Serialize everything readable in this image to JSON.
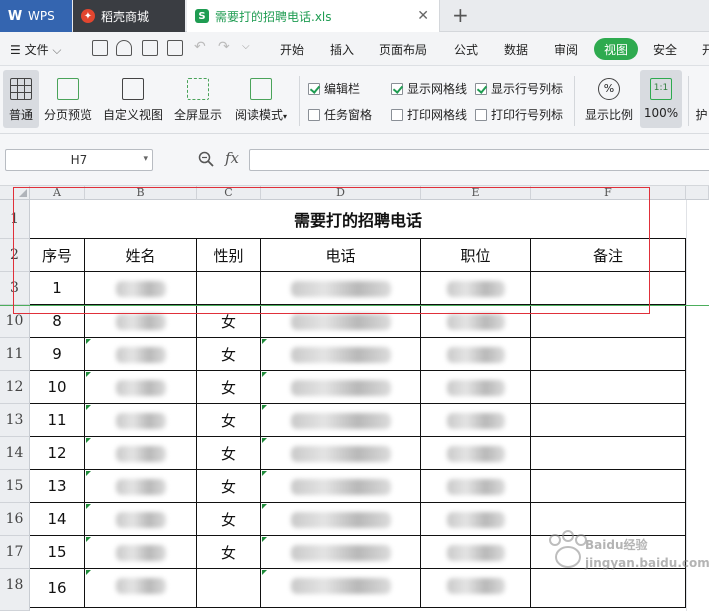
{
  "tabs": {
    "wps": "WPS",
    "store": "稻壳商城",
    "file": "需要打的招聘电话.xls"
  },
  "menu": {
    "file_label": "文件",
    "items": [
      "开始",
      "插入",
      "页面布局",
      "公式",
      "数据",
      "审阅",
      "视图",
      "安全",
      "开"
    ],
    "active": "视图"
  },
  "ribbon": {
    "normal": "普通",
    "page_break": "分页预览",
    "custom_view": "自定义视图",
    "fullscreen": "全屏显示",
    "reading_mode": "阅读模式",
    "edit_bar": "编辑栏",
    "task_pane": "任务窗格",
    "show_gridlines": "显示网格线",
    "print_gridlines": "打印网格线",
    "show_headers": "显示行号列标",
    "print_headers": "打印行号列标",
    "zoom_ratio": "显示比例",
    "zoom_100": "100%",
    "ratio_icon": "1:1",
    "protect": "护"
  },
  "checks": {
    "edit_bar": true,
    "task_pane": false,
    "show_gridlines": true,
    "print_gridlines": false,
    "show_headers": true,
    "print_headers": false
  },
  "formula": {
    "cell_ref": "H7",
    "fx": "fx",
    "value": ""
  },
  "sheet": {
    "columns": [
      "A",
      "B",
      "C",
      "D",
      "E",
      "F"
    ],
    "title": "需要打的招聘电话",
    "headers": [
      "序号",
      "姓名",
      "性别",
      "电话",
      "职位",
      "备注"
    ],
    "row_numbers": [
      "1",
      "2",
      "3",
      "10",
      "11",
      "12",
      "13",
      "14",
      "15",
      "16",
      "17",
      "18"
    ],
    "data_rows": [
      {
        "seq": "1",
        "gender": ""
      },
      {
        "seq": "8",
        "gender": "女"
      },
      {
        "seq": "9",
        "gender": "女"
      },
      {
        "seq": "10",
        "gender": "女"
      },
      {
        "seq": "11",
        "gender": "女"
      },
      {
        "seq": "12",
        "gender": "女"
      },
      {
        "seq": "13",
        "gender": "女"
      },
      {
        "seq": "14",
        "gender": "女"
      },
      {
        "seq": "15",
        "gender": "女"
      },
      {
        "seq": "16",
        "gender": ""
      }
    ]
  },
  "watermark": "Baidu经验 jingyan.baidu.com",
  "colors": {
    "accent": "#2eaa4f",
    "selection": "#e0303a",
    "wps_blue": "#3465b0"
  }
}
